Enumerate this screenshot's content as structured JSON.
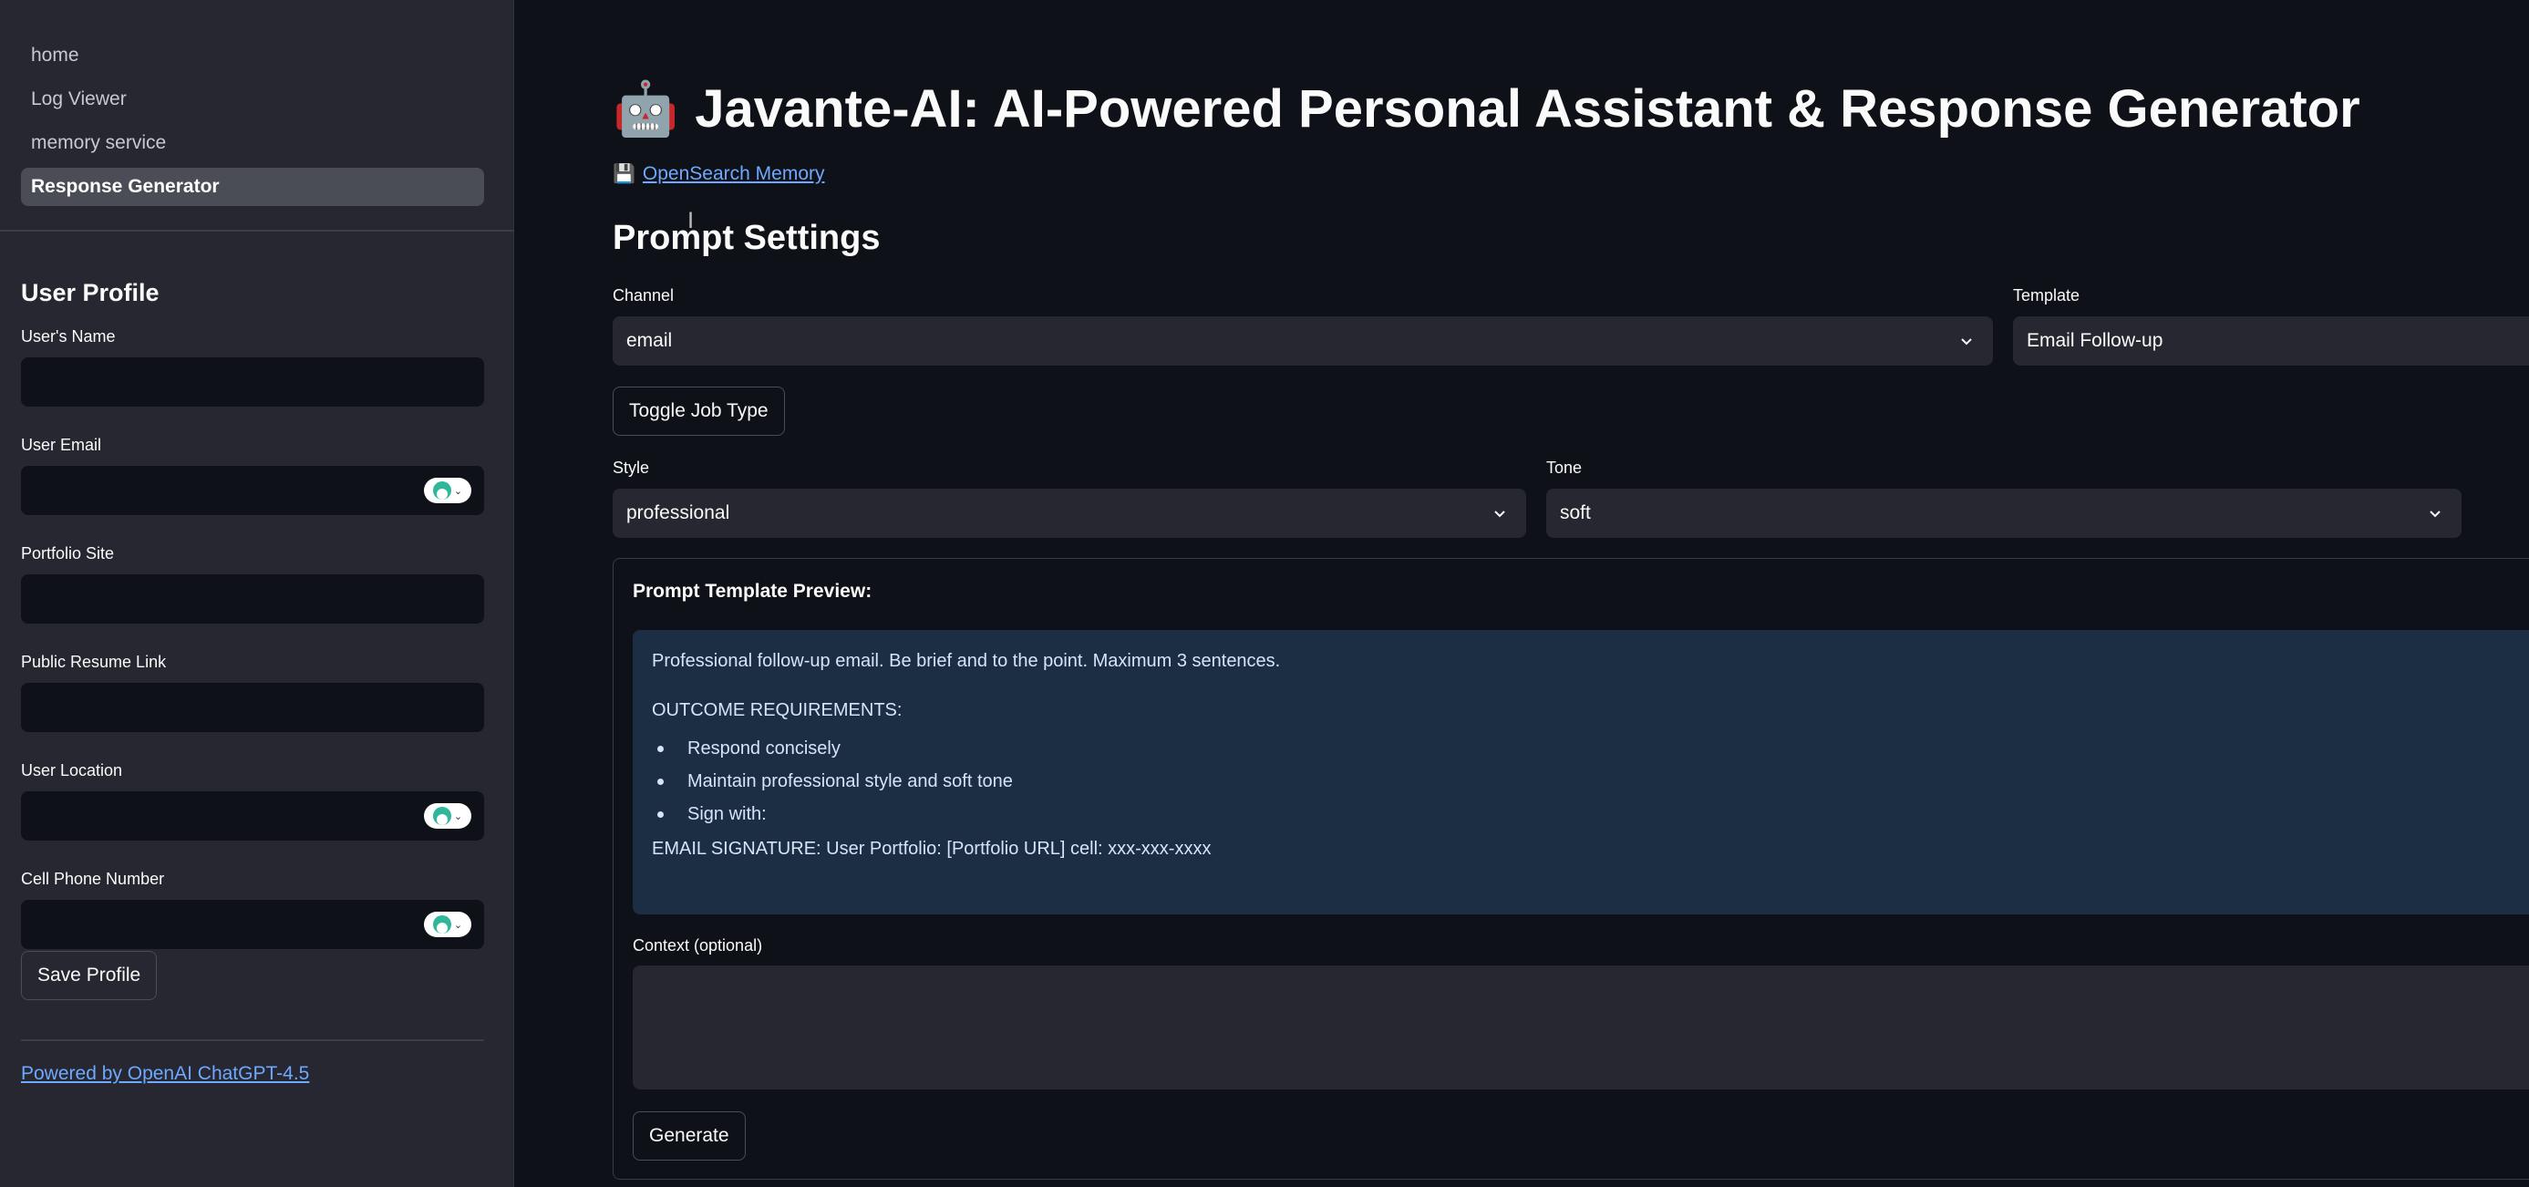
{
  "sidebar": {
    "nav": [
      {
        "label": "home",
        "active": false
      },
      {
        "label": "Log Viewer",
        "active": false
      },
      {
        "label": "memory service",
        "active": false
      },
      {
        "label": "Response Generator",
        "active": true
      }
    ],
    "profile": {
      "heading": "User Profile",
      "fields": {
        "name": {
          "label": "User's Name",
          "value": ""
        },
        "email": {
          "label": "User Email",
          "value": ""
        },
        "portfolio": {
          "label": "Portfolio Site",
          "value": ""
        },
        "resume": {
          "label": "Public Resume Link",
          "value": ""
        },
        "location": {
          "label": "User Location",
          "value": ""
        },
        "phone": {
          "label": "Cell Phone Number",
          "value": ""
        }
      },
      "save_label": "Save Profile"
    },
    "powered_by": "Powered by OpenAI ChatGPT-4.5"
  },
  "main": {
    "title_icon": "🤖",
    "title": "Javante-AI: AI-Powered Personal Assistant & Response Generator",
    "memory_icon": "💾",
    "memory_link": "OpenSearch Memory",
    "section_title": "Prompt Settings",
    "channel": {
      "label": "Channel",
      "value": "email"
    },
    "template": {
      "label": "Template",
      "value": "Email Follow-up"
    },
    "toggle_label": "Toggle Job Type",
    "style": {
      "label": "Style",
      "value": "professional"
    },
    "tone": {
      "label": "Tone",
      "value": "soft"
    },
    "preview": {
      "title": "Prompt Template Preview:",
      "intro": "Professional follow-up email. Be brief and to the point. Maximum 3 sentences.",
      "requirements_heading": "OUTCOME REQUIREMENTS:",
      "requirements": [
        "Respond concisely",
        "Maintain professional style and soft tone",
        "Sign with:"
      ],
      "signature": "EMAIL SIGNATURE: User Portfolio: [Portfolio URL] cell: xxx-xxx-xxxx"
    },
    "context": {
      "label": "Context (optional)",
      "value": ""
    },
    "generate_label": "Generate"
  },
  "colors": {
    "background": "#0e1117",
    "sidebar": "#262730",
    "link": "#6ea8ff",
    "preview_panel": "#1c2e44",
    "extension_badge": "#2fb79b"
  }
}
